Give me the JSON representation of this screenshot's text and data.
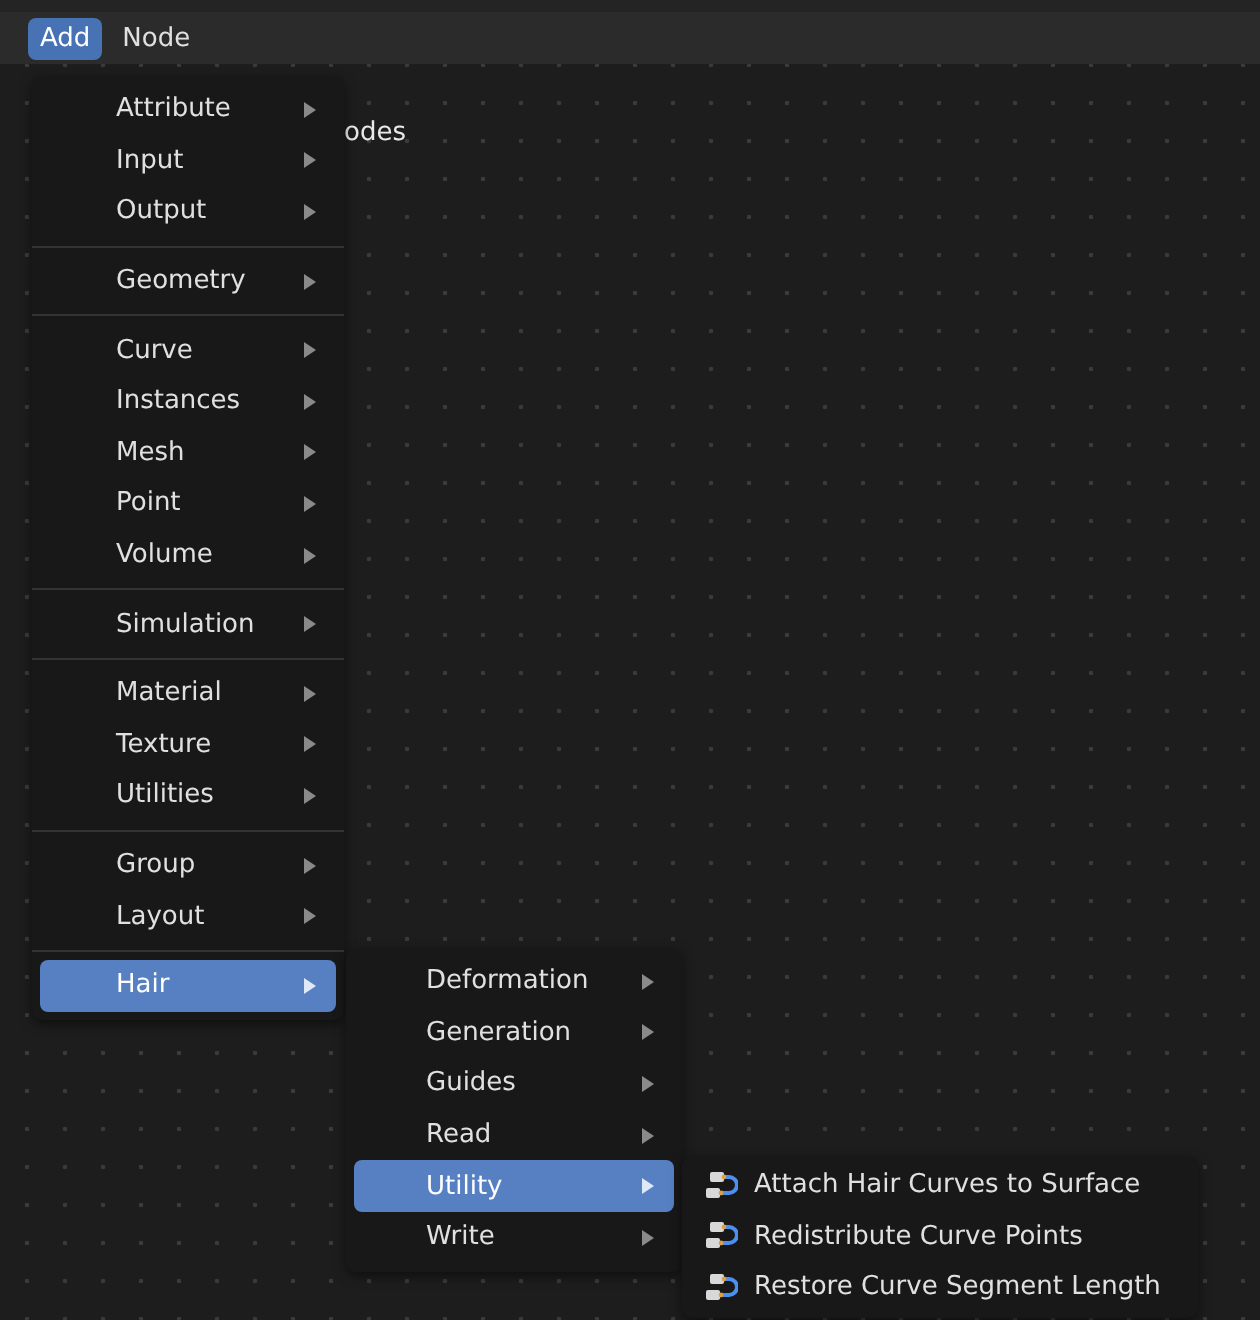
{
  "menubar": [
    {
      "label": "Add",
      "selected": true
    },
    {
      "label": "Node",
      "selected": false
    }
  ],
  "breadcrumb": "odes",
  "add_menu": {
    "groups": [
      [
        {
          "label": "Attribute",
          "selected": false
        },
        {
          "label": "Input",
          "selected": false
        },
        {
          "label": "Output",
          "selected": false
        }
      ],
      [
        {
          "label": "Geometry",
          "selected": false
        }
      ],
      [
        {
          "label": "Curve",
          "selected": false
        },
        {
          "label": "Instances",
          "selected": false
        },
        {
          "label": "Mesh",
          "selected": false
        },
        {
          "label": "Point",
          "selected": false
        },
        {
          "label": "Volume",
          "selected": false
        }
      ],
      [
        {
          "label": "Simulation",
          "selected": false
        }
      ],
      [
        {
          "label": "Material",
          "selected": false
        },
        {
          "label": "Texture",
          "selected": false
        },
        {
          "label": "Utilities",
          "selected": false
        }
      ],
      [
        {
          "label": "Group",
          "selected": false
        },
        {
          "label": "Layout",
          "selected": false
        }
      ],
      [
        {
          "label": "Hair",
          "selected": true
        }
      ]
    ]
  },
  "hair_menu": {
    "items": [
      {
        "label": "Deformation",
        "selected": false
      },
      {
        "label": "Generation",
        "selected": false
      },
      {
        "label": "Guides",
        "selected": false
      },
      {
        "label": "Read",
        "selected": false
      },
      {
        "label": "Utility",
        "selected": true
      },
      {
        "label": "Write",
        "selected": false
      }
    ]
  },
  "utility_menu": {
    "items": [
      {
        "label": "Attach Hair Curves to Surface"
      },
      {
        "label": "Redistribute Curve Points"
      },
      {
        "label": "Restore Curve Segment Length"
      }
    ]
  }
}
